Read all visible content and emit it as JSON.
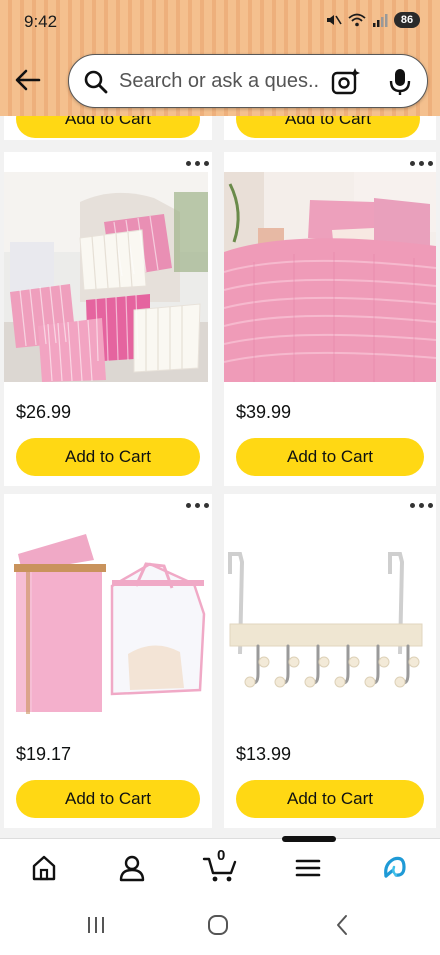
{
  "status_bar": {
    "time": "9:42",
    "battery": "86"
  },
  "header": {
    "search_placeholder": "Search or ask a ques..."
  },
  "previous_row": {
    "left_button": "Add to Cart",
    "right_button": "Add to Cart"
  },
  "products": [
    {
      "name": "pillows",
      "price": "$26.99",
      "button": "Add to Cart"
    },
    {
      "name": "comforter",
      "price": "$39.99",
      "button": "Add to Cart"
    },
    {
      "name": "laundry-hamper",
      "price": "$19.17",
      "button": "Add to Cart"
    },
    {
      "name": "door-hook-rack",
      "price": "$13.99",
      "button": "Add to Cart"
    }
  ],
  "bottom_nav": {
    "cart_count": "0"
  },
  "colors": {
    "accent_button": "#ffd814",
    "header_bg": "#f4c08e",
    "alexa_icon": "#1f9ad6"
  }
}
